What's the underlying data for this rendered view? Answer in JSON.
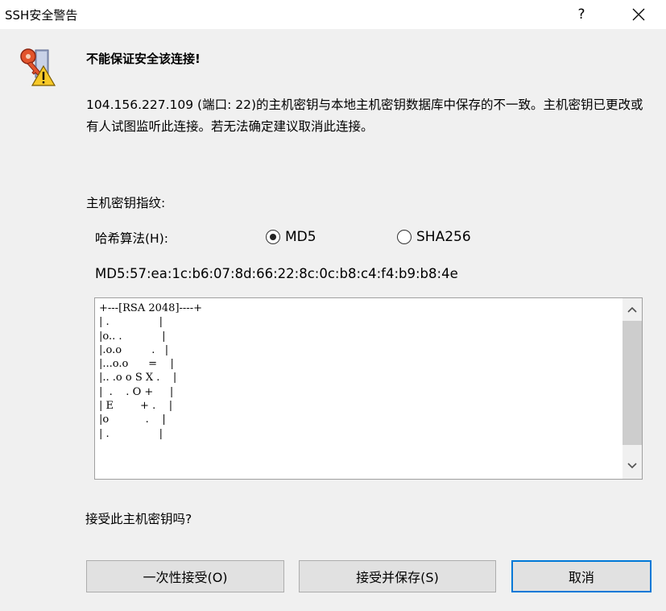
{
  "window": {
    "title": "SSH安全警告",
    "help_label": "?"
  },
  "icons": {
    "close": "close-icon",
    "warning": "key-warning-icon",
    "scroll_up": "chevron-up-icon",
    "scroll_down": "chevron-down-icon"
  },
  "dialog": {
    "headline": "不能保证安全该连接!",
    "description": "104.156.227.109 (端口: 22)的主机密钥与本地主机密钥数据库中保存的不一致。主机密钥已更改或有人试图监听此连接。若无法确定建议取消此连接。",
    "fingerprint_label": "主机密钥指纹:",
    "hash_label": "哈希算法(H):",
    "hash_options": [
      {
        "label": "MD5",
        "selected": true
      },
      {
        "label": "SHA256",
        "selected": false
      }
    ],
    "fingerprint": "MD5:57:ea:1c:b6:07:8d:66:22:8c:0c:b8:c4:f4:b9:b8:4e",
    "randomart": "+---[RSA 2048]----+\n| .               |\n|o.. .            |\n|.o.o         .   |\n|...o.o      =    |\n|.. .o o S X .    |\n|  .    . O +     |\n| E        + .    |\n|o           .    |\n| .               |",
    "accept_question": "接受此主机密钥吗?"
  },
  "buttons": {
    "accept_once": "一次性接受(O)",
    "accept_save": "接受并保存(S)",
    "cancel": "取消"
  },
  "colors": {
    "dialog_bg": "#f0f0f0",
    "button_bg": "#e1e1e1",
    "focus_border": "#0078d7"
  }
}
